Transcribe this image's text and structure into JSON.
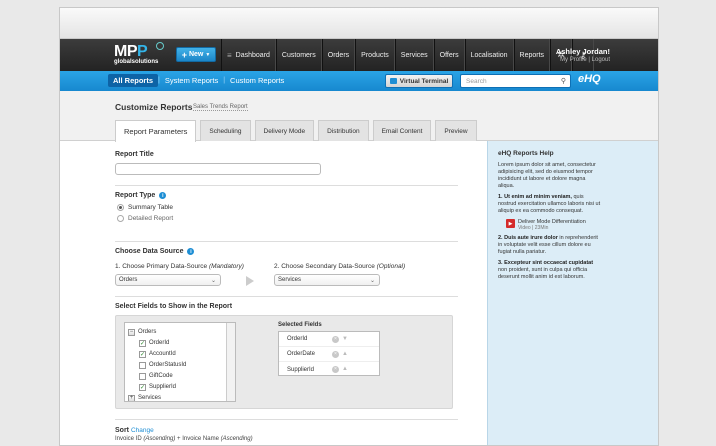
{
  "logo": {
    "brand_a": "MP",
    "brand_b": "P",
    "tagline": "globalsolutions"
  },
  "topbar": {
    "new_label": "New",
    "nav": [
      "Dashboard",
      "Customers",
      "Orders",
      "Products",
      "Services",
      "Offers",
      "Localisation",
      "Reports"
    ],
    "user_name": "Ashley Jordan!",
    "profile_link": "My Profile",
    "logout_link": "Logout"
  },
  "subbar": {
    "tabs": [
      "All Reports",
      "System Reports",
      "Custom Reports"
    ],
    "virtual_terminal": "Virtual Terminal",
    "search_placeholder": "Search",
    "ehq": "eHQ"
  },
  "header": {
    "title": "Customize Reports",
    "breadcrumb": "Sales Trends Report",
    "tabs": [
      "Report Parameters",
      "Scheduling",
      "Delivery Mode",
      "Distribution",
      "Email Content",
      "Preview"
    ]
  },
  "form": {
    "report_title_label": "Report Title",
    "report_type_label": "Report Type",
    "report_types": [
      "Summary Table",
      "Detailed Report"
    ],
    "data_source_label": "Choose Data Source",
    "primary_label": "1. Choose Primary Data-Source",
    "primary_hint": "(Mandatory)",
    "primary_value": "Orders",
    "secondary_label": "2. Choose Secondary Data-Source",
    "secondary_hint": "(Optional)",
    "secondary_value": "Services",
    "fields_label": "Select Fields to Show in the Report",
    "tree_root": "Orders",
    "tree_items": [
      "OrderId",
      "AccountId",
      "OrderStatusId",
      "GiftCode",
      "SupplierId"
    ],
    "tree_checked": [
      true,
      true,
      false,
      false,
      true
    ],
    "tree_next": "Services",
    "selected_label": "Selected Fields",
    "selected_fields": [
      "OrderId",
      "OrderDate",
      "SupplierId"
    ],
    "sort_label": "Sort",
    "sort_change": "Change",
    "sort_a": "Invoice ID",
    "sort_a_dir": "(Ascending)",
    "sort_b": "+ Invoice Name",
    "sort_b_dir": "(Ascending)"
  },
  "help": {
    "title": "eHQ Reports Help",
    "intro": "Lorem ipsum dolor sit amet, consectetur adipisicing elit, sed do eiusmod tempor incididunt ut labore et dolore magna aliqua.",
    "p1_bold": "1. Ut enim ad minim veniam,",
    "p1": " quis nostrud exercitation ullamco laboris nisi ut aliquip ex ea commodo consequat.",
    "video_title": "Deliver Mode Differentiation",
    "video_meta": "Video | 23Min",
    "p2_bold": "2. Duis aute irure dolor",
    "p2": " in reprehenderit in voluptate velit esse cillum dolore eu fugiat nulla pariatur.",
    "p3_bold": "3. Excepteur sint occaecat cupidatat",
    "p3": " non proident, sunt in culpa qui officia deserunt mollit anim id est laborum."
  }
}
